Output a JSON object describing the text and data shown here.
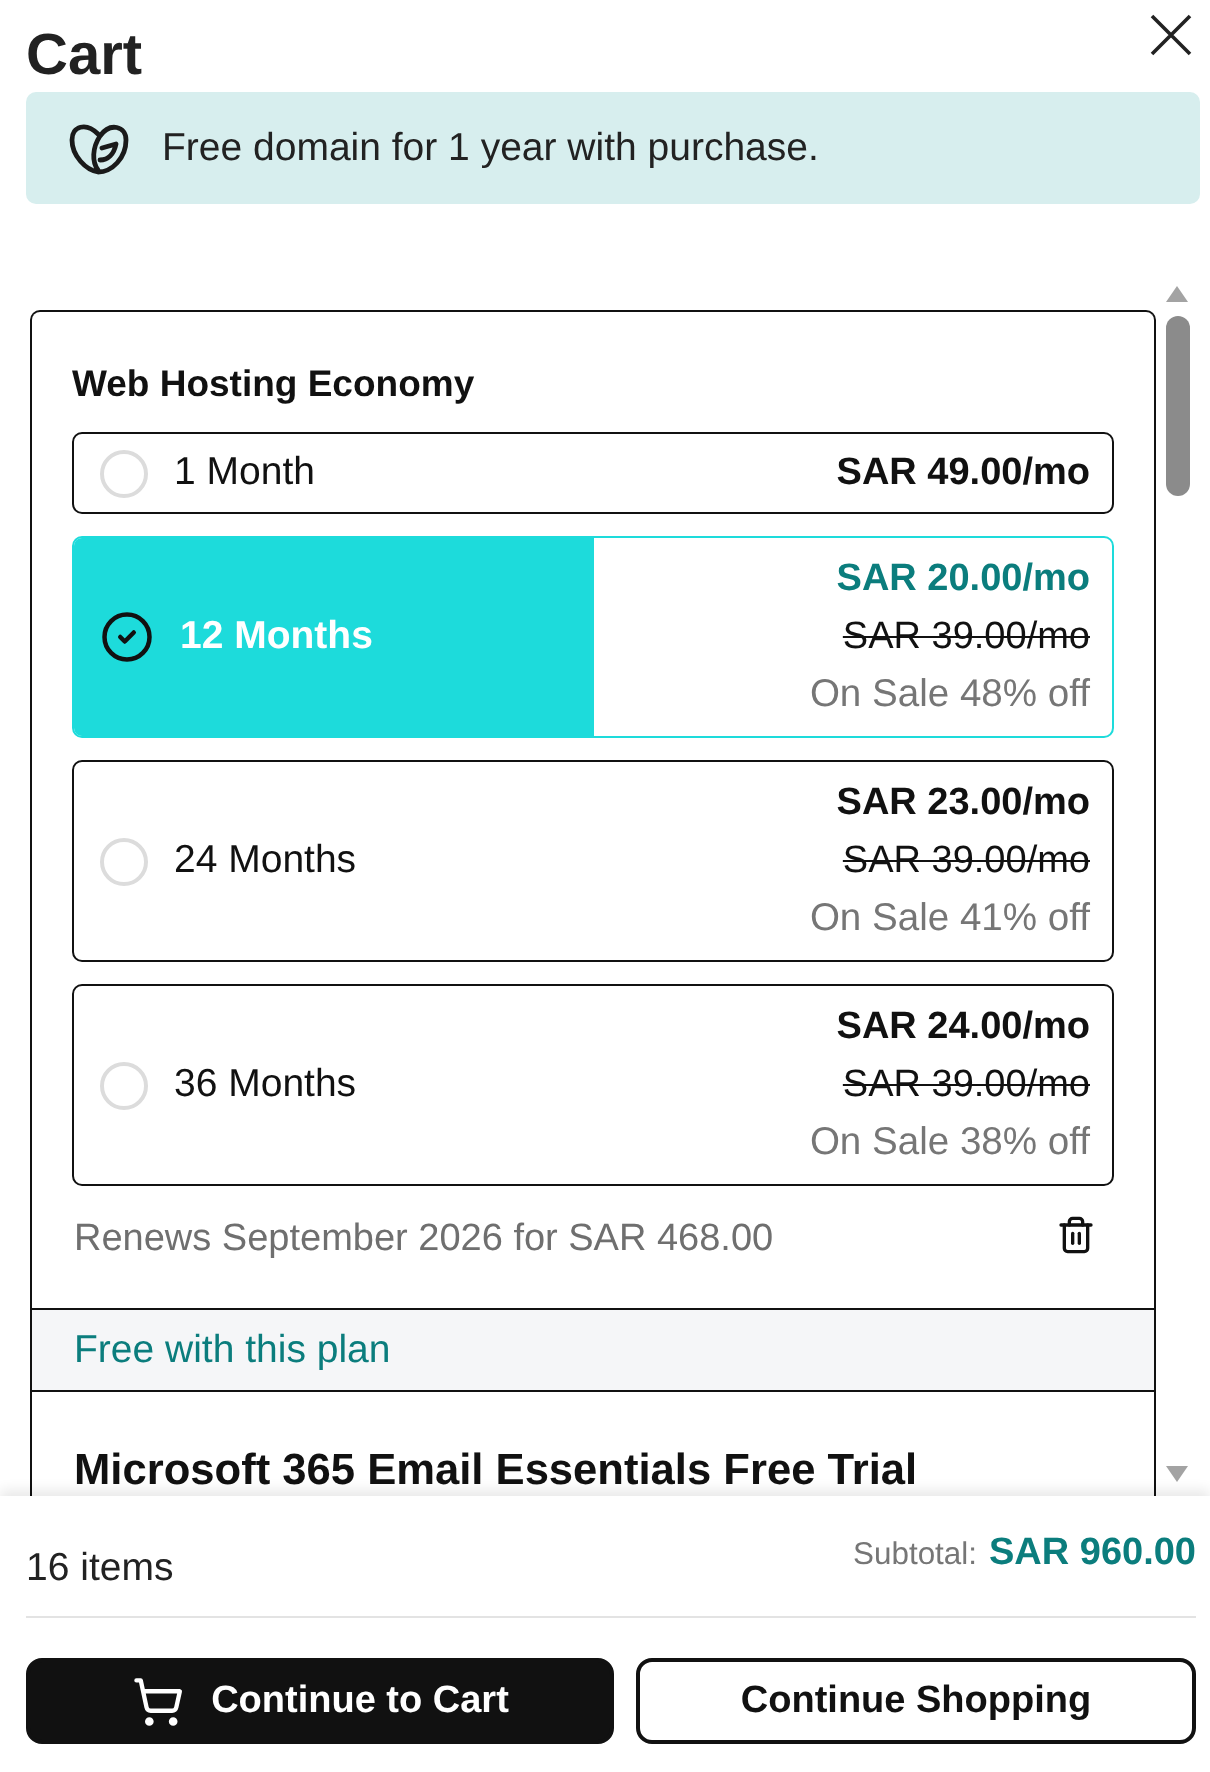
{
  "header": {
    "title": "Cart"
  },
  "banner": {
    "text": "Free domain for 1 year with purchase."
  },
  "cart_items": [
    {
      "title": "Web Hosting Economy",
      "terms": [
        {
          "label": "1 Month",
          "price": "SAR 49.00/mo",
          "selected": false
        },
        {
          "label": "12 Months",
          "price": "SAR 20.00/mo",
          "original_price": "SAR 39.00/mo",
          "sale": "On Sale 48% off",
          "selected": true
        },
        {
          "label": "24 Months",
          "price": "SAR 23.00/mo",
          "original_price": "SAR 39.00/mo",
          "sale": "On Sale 41% off",
          "selected": false
        },
        {
          "label": "36 Months",
          "price": "SAR 24.00/mo",
          "original_price": "SAR 39.00/mo",
          "sale": "On Sale 38% off",
          "selected": false
        }
      ],
      "renewal": "Renews September 2026 for SAR 468.00",
      "included": {
        "heading": "Free with this plan",
        "items": [
          {
            "title": "Microsoft 365 Email Essentials Free Trial"
          }
        ]
      }
    }
  ],
  "footer": {
    "item_count": "16 items",
    "subtotal_label": "Subtotal:",
    "subtotal": "SAR 960.00",
    "buttons": [
      {
        "label": "Continue to Cart",
        "kind": "primary"
      },
      {
        "label": "Continue Shopping",
        "kind": "secondary"
      }
    ]
  }
}
